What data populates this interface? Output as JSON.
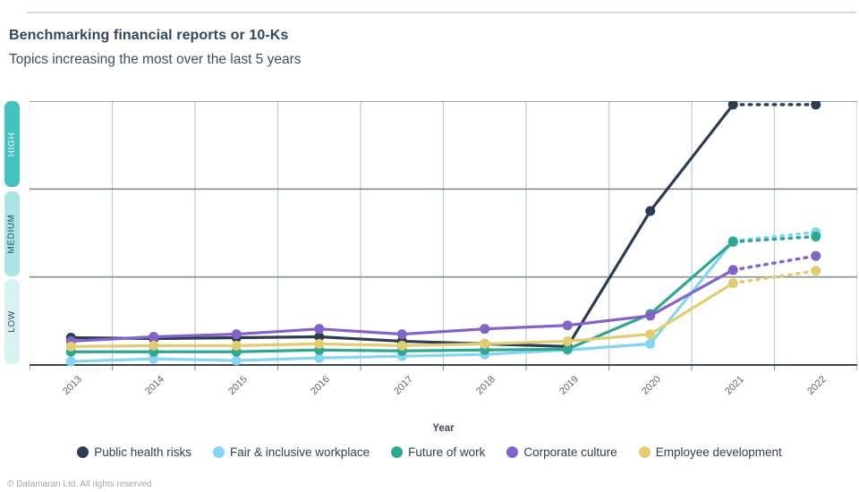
{
  "header": {
    "title": "Benchmarking financial reports or 10-Ks",
    "subtitle": "Topics increasing the most over the last 5 years"
  },
  "y_axis": {
    "bands": [
      {
        "label": "HIGH",
        "color": "#43c2bf",
        "text_color": "#ffffff"
      },
      {
        "label": "MEDIUM",
        "color": "#a9e5e2",
        "text_color": "#33475b"
      },
      {
        "label": "LOW",
        "color": "#d8f2f0",
        "text_color": "#33475b"
      }
    ]
  },
  "x_axis": {
    "label": "Year",
    "ticks": [
      "2013",
      "2014",
      "2015",
      "2016",
      "2017",
      "2018",
      "2019",
      "2020",
      "2021",
      "2022"
    ]
  },
  "legend": [
    {
      "label": "Public health risks",
      "color": "#2b3d4f"
    },
    {
      "label": "Fair & inclusive workplace",
      "color": "#85d4f2"
    },
    {
      "label": "Future of work",
      "color": "#2fa78f"
    },
    {
      "label": "Corporate culture",
      "color": "#8263c7"
    },
    {
      "label": "Employee development",
      "color": "#e1cc71"
    }
  ],
  "footer": {
    "text": "© Datamaran Ltd. All rights reserved"
  },
  "chart_data": {
    "type": "line",
    "title": "Benchmarking financial reports or 10-Ks",
    "subtitle": "Topics increasing the most over the last 5 years",
    "xlabel": "Year",
    "x": [
      "2013",
      "2014",
      "2015",
      "2016",
      "2017",
      "2018",
      "2019",
      "2020",
      "2021",
      "2022"
    ],
    "y_scale_note": "qualitative importance, 0-3: LOW band = 0-1, MEDIUM = 1-2, HIGH = 2-3",
    "ylim": [
      0,
      3
    ],
    "y_band_labels": [
      "LOW",
      "MEDIUM",
      "HIGH"
    ],
    "grid": true,
    "legend_position": "bottom",
    "dashed_segment_from_x": "2021",
    "series": [
      {
        "name": "Public health risks",
        "color": "#2b3d4f",
        "values": [
          0.31,
          0.3,
          0.31,
          0.32,
          0.27,
          0.24,
          0.21,
          1.75,
          2.96,
          2.96
        ]
      },
      {
        "name": "Fair & inclusive workplace",
        "color": "#85d4f2",
        "values": [
          0.04,
          0.07,
          0.05,
          0.08,
          0.1,
          0.12,
          0.17,
          0.24,
          1.41,
          1.51
        ]
      },
      {
        "name": "Future of work",
        "color": "#2fa78f",
        "values": [
          0.15,
          0.15,
          0.15,
          0.17,
          0.16,
          0.17,
          0.18,
          0.58,
          1.4,
          1.46
        ]
      },
      {
        "name": "Corporate culture",
        "color": "#8263c7",
        "values": [
          0.27,
          0.32,
          0.35,
          0.41,
          0.35,
          0.41,
          0.45,
          0.56,
          1.08,
          1.24
        ]
      },
      {
        "name": "Employee development",
        "color": "#e1cc71",
        "values": [
          0.21,
          0.22,
          0.22,
          0.24,
          0.22,
          0.24,
          0.27,
          0.35,
          0.93,
          1.07
        ]
      }
    ]
  }
}
